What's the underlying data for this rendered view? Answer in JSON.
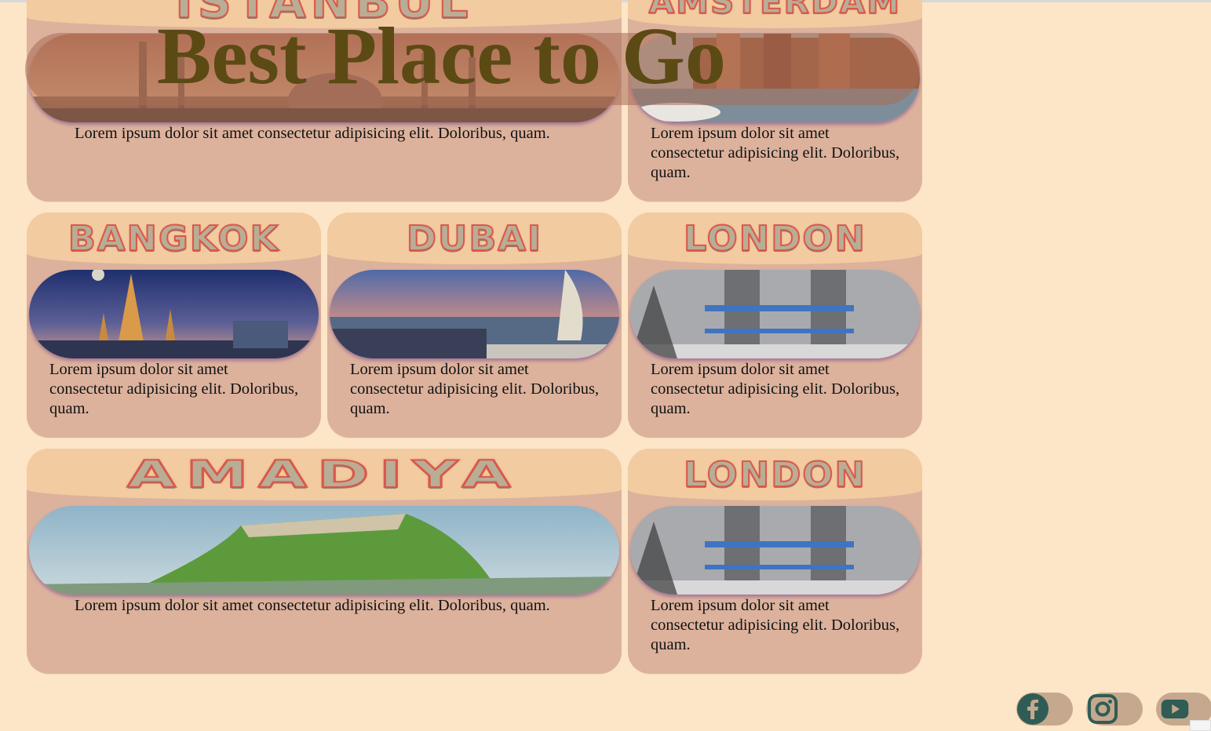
{
  "header": {
    "title": "Best Place to Go"
  },
  "cards": [
    {
      "title": "ISTANBUL",
      "description": "Lorem ipsum dolor sit amet consectetur adipisicing elit. Doloribus, quam."
    },
    {
      "title": "AMSTERDAM",
      "description": "Lorem ipsum dolor sit amet consectetur adipisicing elit. Doloribus, quam."
    },
    {
      "title": "BANGKOK",
      "description": "Lorem ipsum dolor sit amet consectetur adipisicing elit. Doloribus, quam."
    },
    {
      "title": "DUBAI",
      "description": "Lorem ipsum dolor sit amet consectetur adipisicing elit. Doloribus, quam."
    },
    {
      "title": "LONDON",
      "description": "Lorem ipsum dolor sit amet consectetur adipisicing elit. Doloribus, quam."
    },
    {
      "title": "AMADIYA",
      "description": "Lorem ipsum dolor sit amet consectetur adipisicing elit. Doloribus, quam."
    },
    {
      "title": "LONDON",
      "description": "Lorem ipsum dolor sit amet consectetur adipisicing elit. Doloribus, quam."
    }
  ],
  "social": [
    {
      "icon": "facebook-icon"
    },
    {
      "icon": "instagram-icon"
    },
    {
      "icon": "youtube-icon"
    }
  ],
  "colors": {
    "page_bg": "#fde5c7",
    "card_bg": "#dcb29d",
    "title_band": "#f2cba0",
    "header_text": "#5b4a14",
    "social_icon": "#2f5d55"
  }
}
